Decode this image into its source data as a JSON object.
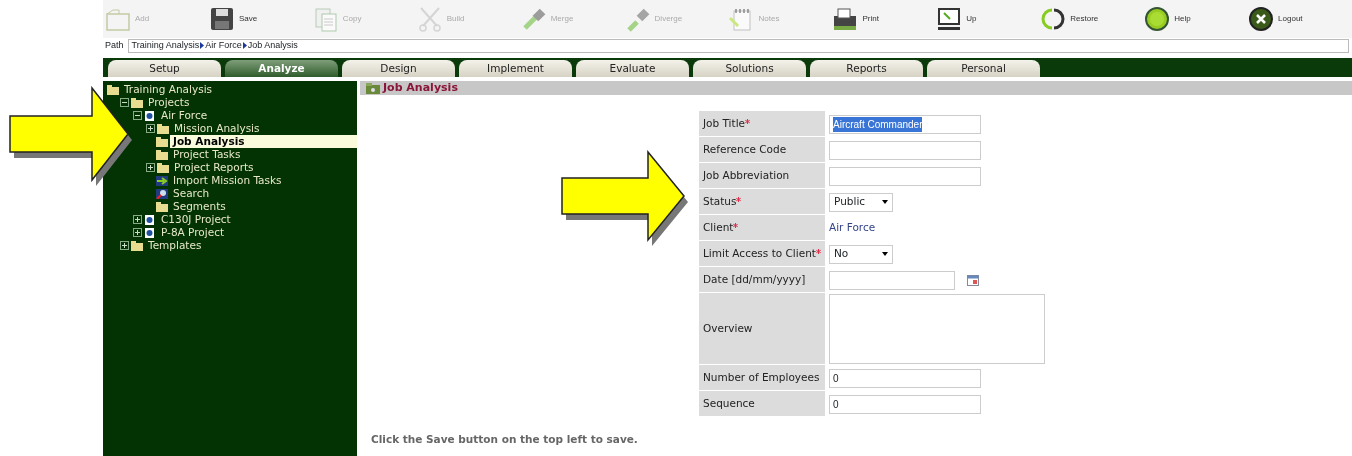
{
  "toolbar": [
    {
      "kind": "add",
      "label": "Add",
      "disabled": true
    },
    {
      "kind": "save",
      "label": "Save",
      "disabled": false
    },
    {
      "kind": "copy",
      "label": "Copy",
      "disabled": true
    },
    {
      "kind": "cut",
      "label": "Build",
      "disabled": true
    },
    {
      "kind": "merge",
      "label": "Merge",
      "disabled": true
    },
    {
      "kind": "diverge",
      "label": "Diverge",
      "disabled": true
    },
    {
      "kind": "notes",
      "label": "Notes",
      "disabled": true
    },
    {
      "kind": "print",
      "label": "Print",
      "disabled": false
    },
    {
      "kind": "up",
      "label": "Up",
      "disabled": false
    },
    {
      "kind": "restore",
      "label": "Restore",
      "disabled": false
    },
    {
      "kind": "help",
      "label": "Help",
      "disabled": false
    },
    {
      "kind": "logout",
      "label": "Logout",
      "disabled": false
    }
  ],
  "path": {
    "label": "Path",
    "crumbs": [
      "Training Analysis",
      "Air Force",
      "Job Analysis"
    ]
  },
  "tabs": [
    {
      "label": "Setup",
      "selected": false
    },
    {
      "label": "Analyze",
      "selected": true
    },
    {
      "label": "Design",
      "selected": false
    },
    {
      "label": "Implement",
      "selected": false
    },
    {
      "label": "Evaluate",
      "selected": false
    },
    {
      "label": "Solutions",
      "selected": false
    },
    {
      "label": "Reports",
      "selected": false
    },
    {
      "label": "Personal",
      "selected": false
    }
  ],
  "tree": [
    {
      "label": "Training Analysis",
      "kind": "folder",
      "selected": false,
      "children": [
        {
          "label": "Projects",
          "kind": "folder",
          "selected": false,
          "expanded": true,
          "children": [
            {
              "label": "Air Force",
              "kind": "project",
              "selected": false,
              "expanded": true,
              "children": [
                {
                  "label": "Mission Analysis",
                  "kind": "folder",
                  "selected": false,
                  "expanded": false
                },
                {
                  "label": "Job Analysis",
                  "kind": "folder",
                  "selected": true
                },
                {
                  "label": "Project Tasks",
                  "kind": "folder",
                  "selected": false
                },
                {
                  "label": "Project Reports",
                  "kind": "folder",
                  "selected": false,
                  "expanded": false
                },
                {
                  "label": "Import Mission Tasks",
                  "kind": "import",
                  "selected": false
                },
                {
                  "label": "Search",
                  "kind": "search",
                  "selected": false
                },
                {
                  "label": "Segments",
                  "kind": "folder",
                  "selected": false
                }
              ]
            },
            {
              "label": "C130J Project",
              "kind": "project",
              "selected": false,
              "expanded": false
            },
            {
              "label": "P-8A Project",
              "kind": "project",
              "selected": false,
              "expanded": false
            }
          ]
        },
        {
          "label": "Templates",
          "kind": "folder",
          "selected": false,
          "expanded": false
        }
      ]
    }
  ],
  "heading": "Job Analysis",
  "fields": [
    {
      "label": "Job Title",
      "required": true,
      "kind": "text",
      "value": "Aircraft Commander",
      "highlighted": true
    },
    {
      "label": "Reference Code",
      "required": false,
      "kind": "text"
    },
    {
      "label": "Job Abbreviation",
      "required": false,
      "kind": "text"
    },
    {
      "label": "Status",
      "required": true,
      "kind": "select",
      "value": "Public"
    },
    {
      "label": "Client",
      "required": true,
      "kind": "static",
      "value": "Air Force"
    },
    {
      "label": "Limit Access to Client",
      "required": true,
      "kind": "select",
      "value": "No"
    },
    {
      "label": "Date [dd/mm/yyyy]",
      "required": false,
      "kind": "date"
    },
    {
      "label": "Overview",
      "required": false,
      "kind": "textarea"
    },
    {
      "label": "Number of Employees",
      "required": false,
      "kind": "text",
      "value": "0"
    },
    {
      "label": "Sequence",
      "required": false,
      "kind": "text",
      "value": "0"
    }
  ],
  "footer": "Click the Save button on the top left to save."
}
